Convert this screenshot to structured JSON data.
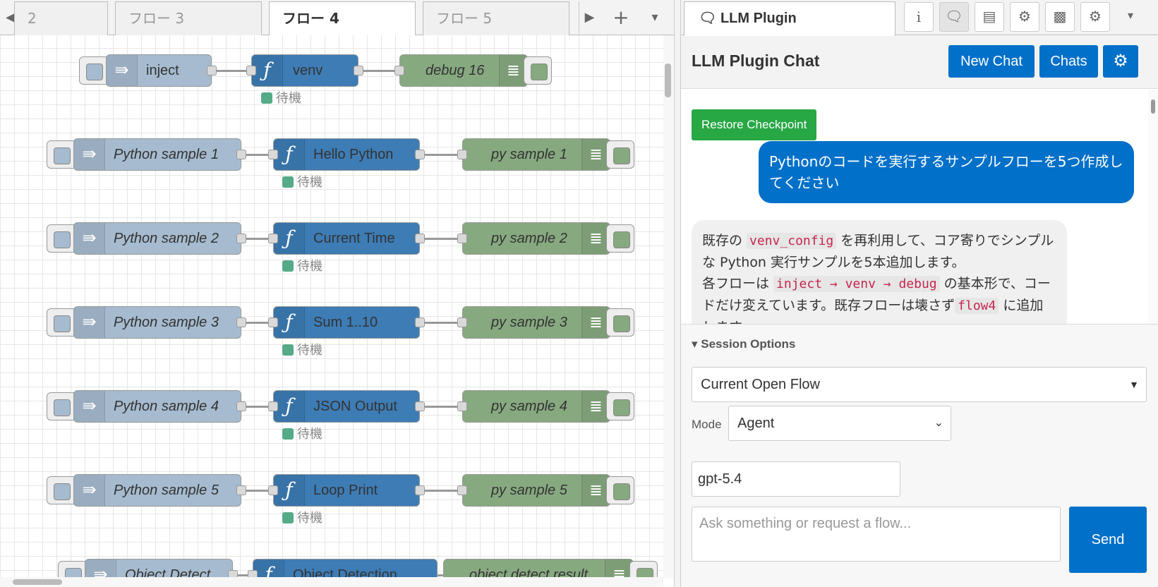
{
  "tabs": [
    {
      "label": "2"
    },
    {
      "label": "フロー 3"
    },
    {
      "label": "フロー 4"
    },
    {
      "label": "フロー 5"
    }
  ],
  "toolbar": {
    "add": "+",
    "menu": "▾",
    "scroll_left": "◀",
    "scroll_right": "▶"
  },
  "status_waiting": "待機",
  "flows": [
    {
      "inject": "inject",
      "func": "venv",
      "debug": "debug 16"
    },
    {
      "inject": "Python sample 1",
      "func": "Hello Python",
      "debug": "py sample 1"
    },
    {
      "inject": "Python sample 2",
      "func": "Current Time",
      "debug": "py sample 2"
    },
    {
      "inject": "Python sample 3",
      "func": "Sum 1..10",
      "debug": "py sample 3"
    },
    {
      "inject": "Python sample 4",
      "func": "JSON Output",
      "debug": "py sample 4"
    },
    {
      "inject": "Python sample 5",
      "func": "Loop Print",
      "debug": "py sample 5"
    },
    {
      "inject": "Object Detect",
      "func": "Object Detection",
      "debug": "object detect result"
    }
  ],
  "sidebar": {
    "tab_label": "LLM Plugin",
    "icons": [
      "info-icon",
      "chat-icon",
      "book-icon",
      "bug-icon",
      "chart-icon",
      "gear-icon",
      "chevron-down-icon"
    ]
  },
  "chat": {
    "title": "LLM Plugin Chat",
    "new_chat": "New Chat",
    "chats": "Chats",
    "restore": "Restore Checkpoint",
    "user_message": "Pythonのコードを実行するサンプルフローを5つ作成してください",
    "assistant": {
      "t1": "既存の ",
      "code1": "venv_config",
      "t2": " を再利用して、コア寄りでシンプルな Python 実行サンプルを5本追加します。",
      "t3": "各フローは ",
      "code2": "inject → venv → debug",
      "t4": " の基本形で、コードだけ変えています。既存フローは壊さず",
      "code3": "flow4",
      "t5": " に追加します。"
    }
  },
  "options": {
    "session_label": "▾ Session Options",
    "scope": "Current Open Flow",
    "mode_label": "Mode",
    "mode": "Agent",
    "model": "gpt-5.4",
    "placeholder": "Ask something or request a flow...",
    "send": "Send"
  },
  "colors": {
    "primary": "#0070c9",
    "success": "#28a745",
    "inject": "#a6bbcf",
    "function": "#3d7cb5",
    "debug": "#87a980"
  }
}
